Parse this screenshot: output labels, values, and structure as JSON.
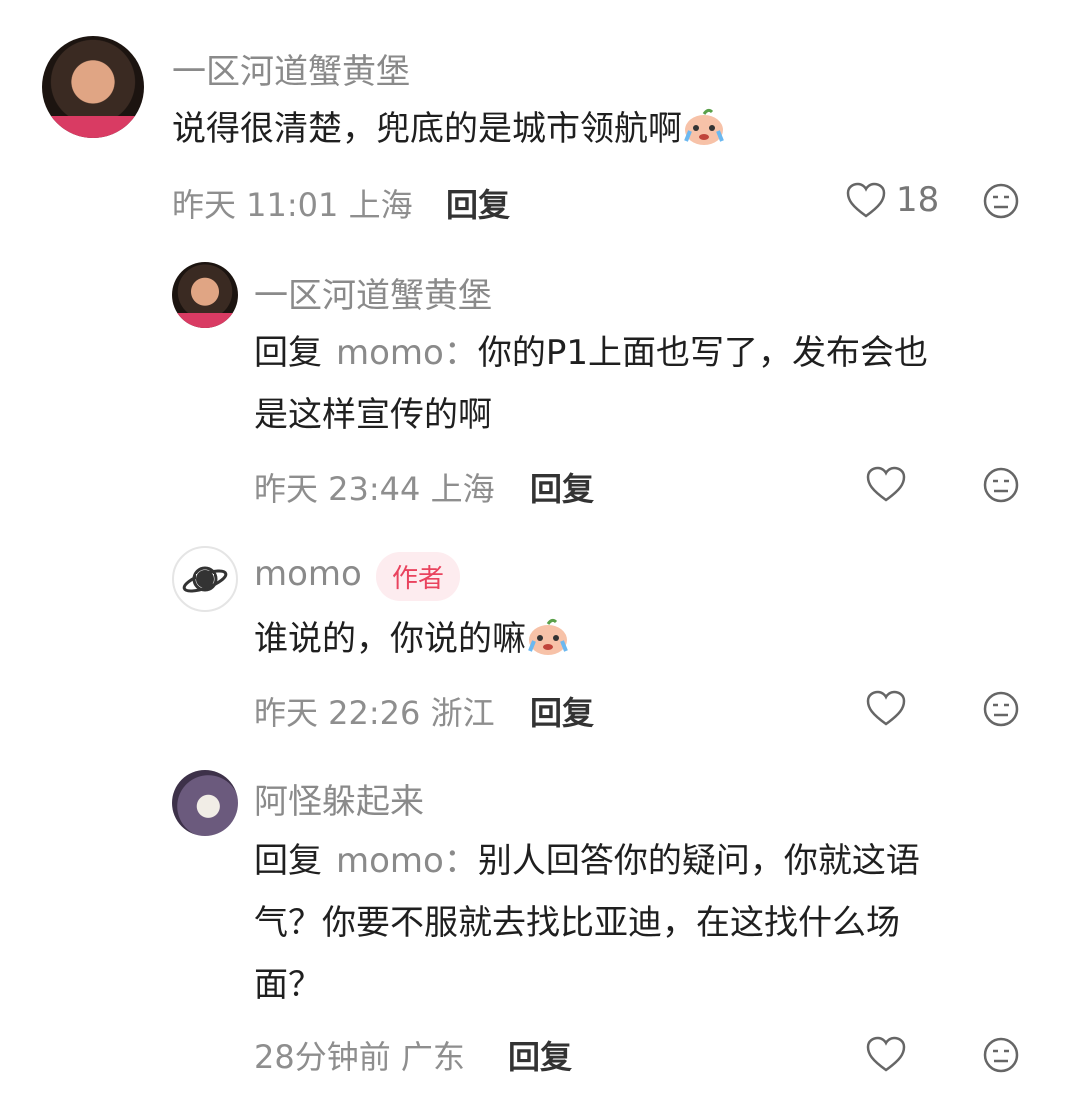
{
  "comments": [
    {
      "name": "一区河道蟹黄堡",
      "text": "说得很清楚，兜底的是城市领航啊",
      "time": "昨天 11:01",
      "location": "上海",
      "reply_label": "回复",
      "likes": "18",
      "avatar_icon": "user-photo-icon"
    },
    {
      "name": "一区河道蟹黄堡",
      "reply_prefix": "回复",
      "reply_to": "momo：",
      "text_line1": "你的P1上面也写了，发布会也",
      "text_line2": "是这样宣传的啊",
      "time": "昨天 23:44",
      "location": "上海",
      "reply_label": "回复"
    },
    {
      "name": "momo",
      "badge": "作者",
      "text": "谁说的，你说的嘛",
      "time": "昨天 22:26",
      "location": "浙江",
      "reply_label": "回复",
      "avatar_icon": "saturn-icon"
    },
    {
      "name": "阿怪躲起来",
      "reply_prefix": "回复",
      "reply_to": "momo：",
      "text_line1": "别人回答你的疑问，你就这语",
      "text_line2": "气？你要不服就去找比亚迪，在这找什么场",
      "text_line3": "面？",
      "time": "28分钟前",
      "location": "广东",
      "reply_label": "回复",
      "avatar_icon": "cat-photo-icon"
    }
  ],
  "colors": {
    "secondary_text": "#8a8a8a",
    "author_badge": "#e9435e",
    "author_badge_bg": "#fdecef"
  }
}
